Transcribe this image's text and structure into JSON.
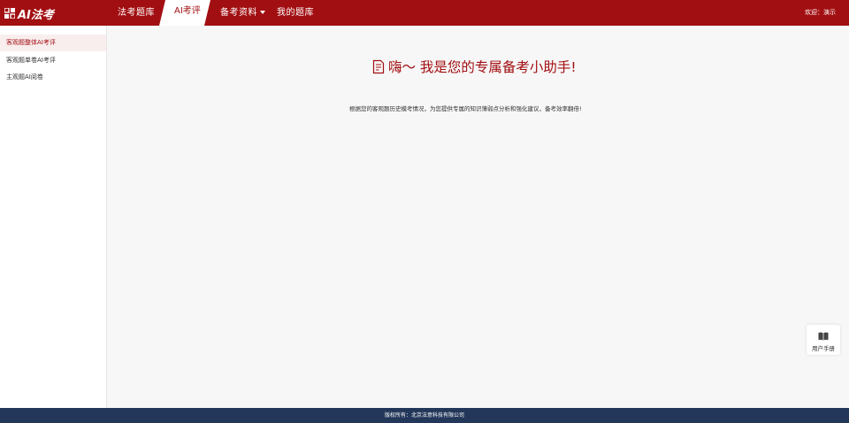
{
  "brand": {
    "logo_text": "AI法考"
  },
  "nav": {
    "items": [
      {
        "label": "法考题库"
      },
      {
        "label": "AI考评"
      },
      {
        "label": "备考资料"
      },
      {
        "label": "我的题库"
      }
    ],
    "active_index": 1,
    "welcome": "欢迎：演示"
  },
  "sidebar": {
    "items": [
      {
        "label": "客观题整体AI考评",
        "active": true
      },
      {
        "label": "客观题单卷AI考评",
        "active": false
      },
      {
        "label": "主观题AI阅卷",
        "active": false
      }
    ]
  },
  "main": {
    "greeting": "嗨～ 我是您的专属备考小助手!",
    "description": "根据您的客观题历史模考情况，为您提供专属的知识薄弱点分析和强化建议，备考效率翻倍!"
  },
  "manual_button": {
    "label": "用户手册",
    "icon": "book-icon"
  },
  "footer": {
    "text": "版权所有：北京法意科技有限公司"
  },
  "colors": {
    "brand_red": "#a20f12",
    "footer_navy": "#23375a",
    "background": "#f7f7f7"
  }
}
